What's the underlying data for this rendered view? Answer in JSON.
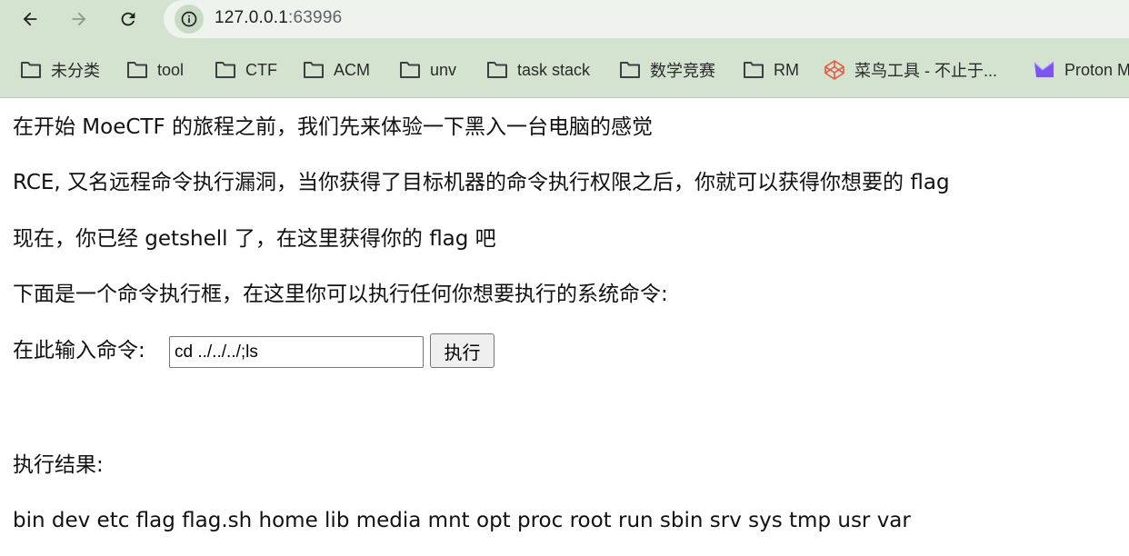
{
  "browser": {
    "url_host": "127.0.0.1",
    "url_port": ":63996",
    "bookmarks": [
      {
        "label": "未分类",
        "icon": "folder-icon"
      },
      {
        "label": "tool",
        "icon": "folder-icon"
      },
      {
        "label": "CTF",
        "icon": "folder-icon"
      },
      {
        "label": "ACM",
        "icon": "folder-icon"
      },
      {
        "label": "unv",
        "icon": "folder-icon"
      },
      {
        "label": "task stack",
        "icon": "folder-icon"
      },
      {
        "label": "数学竞赛",
        "icon": "folder-icon"
      },
      {
        "label": "RM",
        "icon": "folder-icon"
      },
      {
        "label": "菜鸟工具 - 不止于...",
        "icon": "codepen-icon"
      },
      {
        "label": "Proton M",
        "icon": "proton-icon"
      }
    ]
  },
  "page": {
    "line1": "在开始 MoeCTF 的旅程之前，我们先来体验一下黑入一台电脑的感觉",
    "line2": "RCE, 又名远程命令执行漏洞，当你获得了目标机器的命令执行权限之后，你就可以获得你想要的 flag",
    "line3": "现在，你已经 getshell 了，在这里获得你的 flag 吧",
    "line4": "下面是一个命令执行框，在这里你可以执行任何你想要执行的系统命令:",
    "input_label": "在此输入命令:",
    "input_value": "cd ../../../;ls",
    "exec_button": "执行",
    "result_label": "执行结果:",
    "result_output": "bin dev etc flag flag.sh home lib media mnt opt proc root run sbin srv sys tmp usr var"
  },
  "colors": {
    "chrome_bg": "#d3e3d0",
    "omnibox_bg": "#eef3ed"
  }
}
